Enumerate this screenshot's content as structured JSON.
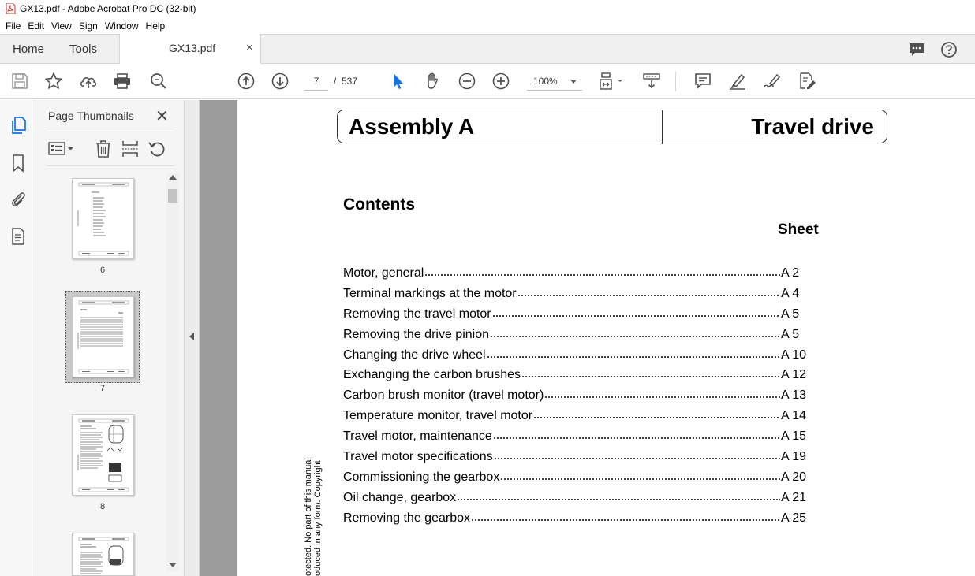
{
  "window": {
    "title": "GX13.pdf - Adobe Acrobat Pro DC (32-bit)"
  },
  "menu": {
    "items": [
      "File",
      "Edit",
      "View",
      "Sign",
      "Window",
      "Help"
    ]
  },
  "tabs": {
    "home": "Home",
    "tools": "Tools",
    "document": "GX13.pdf",
    "close_glyph": "×"
  },
  "toolbar": {
    "current_page": "7",
    "page_separator": "/",
    "total_pages": "537",
    "zoom": "100%"
  },
  "thumbnails_panel": {
    "title": "Page Thumbnails",
    "close_glyph": "✕",
    "pages": [
      {
        "label": "6",
        "selected": false
      },
      {
        "label": "7",
        "selected": true
      },
      {
        "label": "8",
        "selected": false
      },
      {
        "label": "",
        "selected": false
      }
    ]
  },
  "document": {
    "header_left": "Assembly A",
    "header_right": "Travel drive",
    "contents_heading": "Contents",
    "sheet_heading": "Sheet",
    "toc": [
      {
        "title": "Motor, general",
        "sheet": "A 2"
      },
      {
        "title": "Terminal markings at the motor",
        "sheet": "A 4"
      },
      {
        "title": "Removing the travel motor",
        "sheet": "A 5"
      },
      {
        "title": "Removing the drive pinion",
        "sheet": "A 5"
      },
      {
        "title": "Changing the drive wheel",
        "sheet": "A 10"
      },
      {
        "title": "Exchanging the carbon brushes",
        "sheet": "A 12"
      },
      {
        "title": "Carbon brush monitor (travel motor)",
        "sheet": "A 13"
      },
      {
        "title": "Temperature monitor, travel motor",
        "sheet": "A 14"
      },
      {
        "title": "Travel motor, maintenance",
        "sheet": "A 15"
      },
      {
        "title": "Travel motor specifications",
        "sheet": "A 19"
      },
      {
        "title": "Commissioning the gearbox",
        "sheet": "A 20"
      },
      {
        "title": "Oil change, gearbox",
        "sheet": "A 21"
      },
      {
        "title": "Removing the gearbox",
        "sheet": "A 25"
      }
    ],
    "vertical_note_line1": "otected. No part of this manual",
    "vertical_note_line2": "oduced in any form. Copyright"
  },
  "colors": {
    "accent_blue": "#1473e6",
    "icon_gray": "#505050",
    "pdf_red": "#d9342b"
  }
}
